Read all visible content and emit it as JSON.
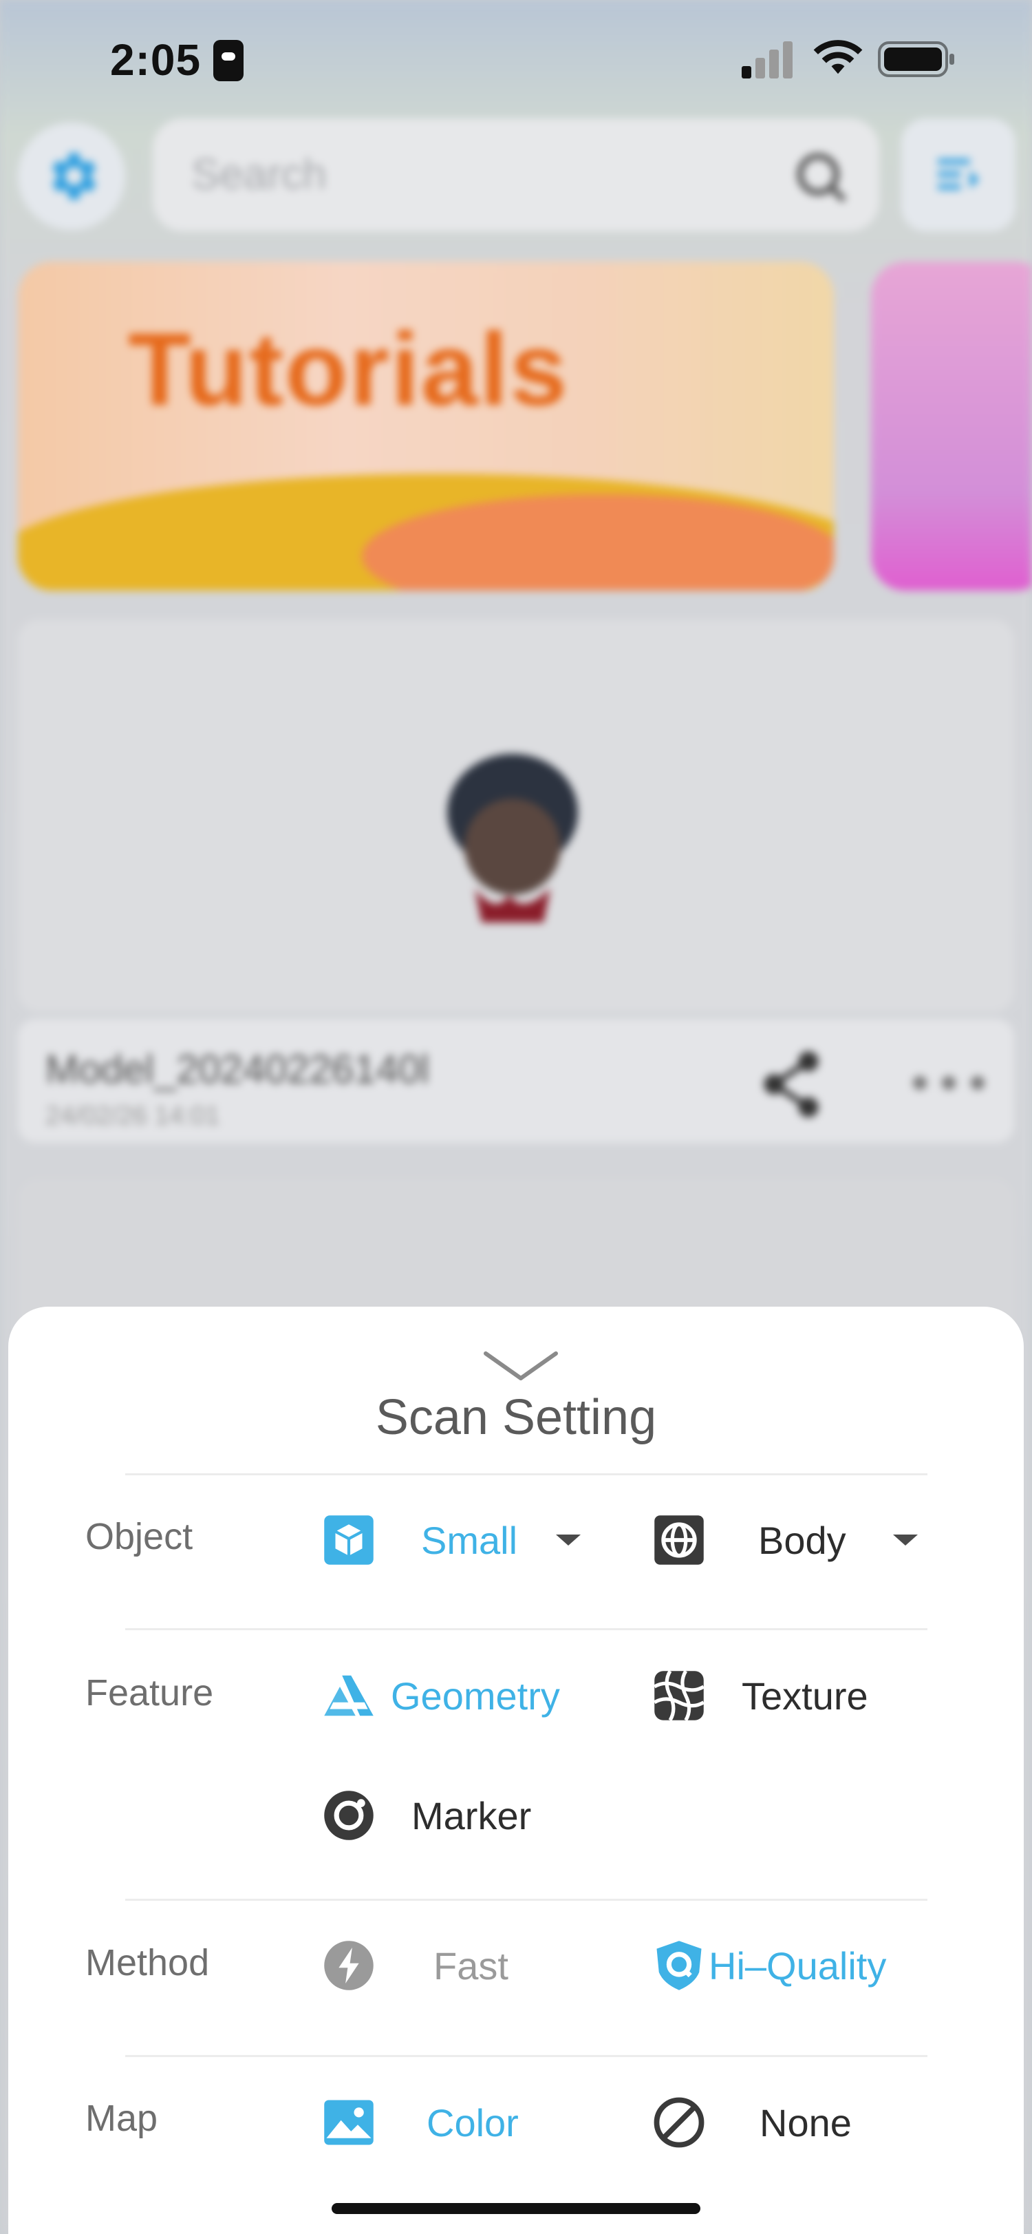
{
  "status_bar": {
    "time": "2:05"
  },
  "background": {
    "search": {
      "placeholder": "Search"
    },
    "banner": {
      "title": "Tutorials"
    },
    "model": {
      "name": "Model_20240226140l",
      "date": "24/02/26 14:01"
    }
  },
  "sheet": {
    "title": "Scan Setting",
    "rows": {
      "object": {
        "label": "Object",
        "options": [
          {
            "label": "Small",
            "icon": "cube-icon",
            "selected": true
          },
          {
            "label": "Body",
            "icon": "body-scan-icon",
            "selected": false
          }
        ]
      },
      "feature": {
        "label": "Feature",
        "options": [
          {
            "label": "Geometry",
            "icon": "geometry-icon",
            "selected": true
          },
          {
            "label": "Texture",
            "icon": "texture-icon",
            "selected": false
          },
          {
            "label": "Marker",
            "icon": "marker-icon",
            "selected": false
          }
        ]
      },
      "method": {
        "label": "Method",
        "options": [
          {
            "label": "Fast",
            "icon": "lightning-icon",
            "selected": false
          },
          {
            "label": "Hi–Quality",
            "icon": "hi-quality-shield-icon",
            "selected": true
          }
        ]
      },
      "map": {
        "label": "Map",
        "options": [
          {
            "label": "Color",
            "icon": "image-icon",
            "selected": true
          },
          {
            "label": "None",
            "icon": "none-icon",
            "selected": false
          }
        ]
      }
    }
  },
  "colors": {
    "accent": "#3fb2e6",
    "text": "#2d2d2d",
    "label": "#6e6e6e"
  }
}
